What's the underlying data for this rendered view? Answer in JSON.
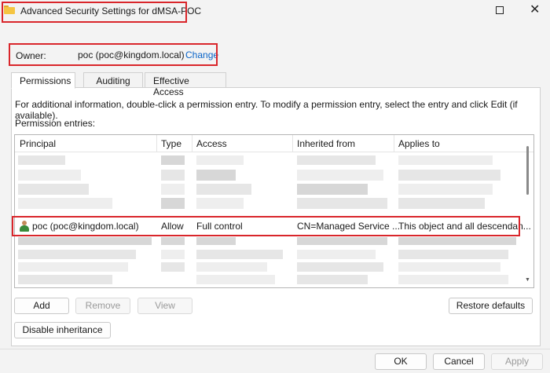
{
  "window": {
    "title": "Advanced Security Settings for dMSA-POC"
  },
  "owner": {
    "label": "Owner:",
    "value": "poc (poc@kingdom.local)",
    "change_link": "Change"
  },
  "tabs": [
    {
      "label": "Permissions",
      "active": true
    },
    {
      "label": "Auditing",
      "active": false
    },
    {
      "label": "Effective Access",
      "active": false
    }
  ],
  "info_text": "For additional information, double-click a permission entry. To modify a permission entry, select the entry and click Edit (if available).",
  "entries_label": "Permission entries:",
  "columns": [
    "Principal",
    "Type",
    "Access",
    "Inherited from",
    "Applies to"
  ],
  "highlighted_entry": {
    "principal": "poc (poc@kingdom.local)",
    "type": "Allow",
    "access": "Full control",
    "inherited_from": "CN=Managed Service ...",
    "applies_to": "This object and all descendan..."
  },
  "list_buttons": {
    "add": "Add",
    "remove": "Remove",
    "view": "View",
    "restore": "Restore defaults"
  },
  "disable_inheritance": "Disable inheritance",
  "footer": {
    "ok": "OK",
    "cancel": "Cancel",
    "apply": "Apply"
  },
  "colors": {
    "highlight": "#d9262b",
    "link": "#0a64c8"
  },
  "icons": {
    "app": "folder-icon",
    "principal": "user-icon"
  }
}
